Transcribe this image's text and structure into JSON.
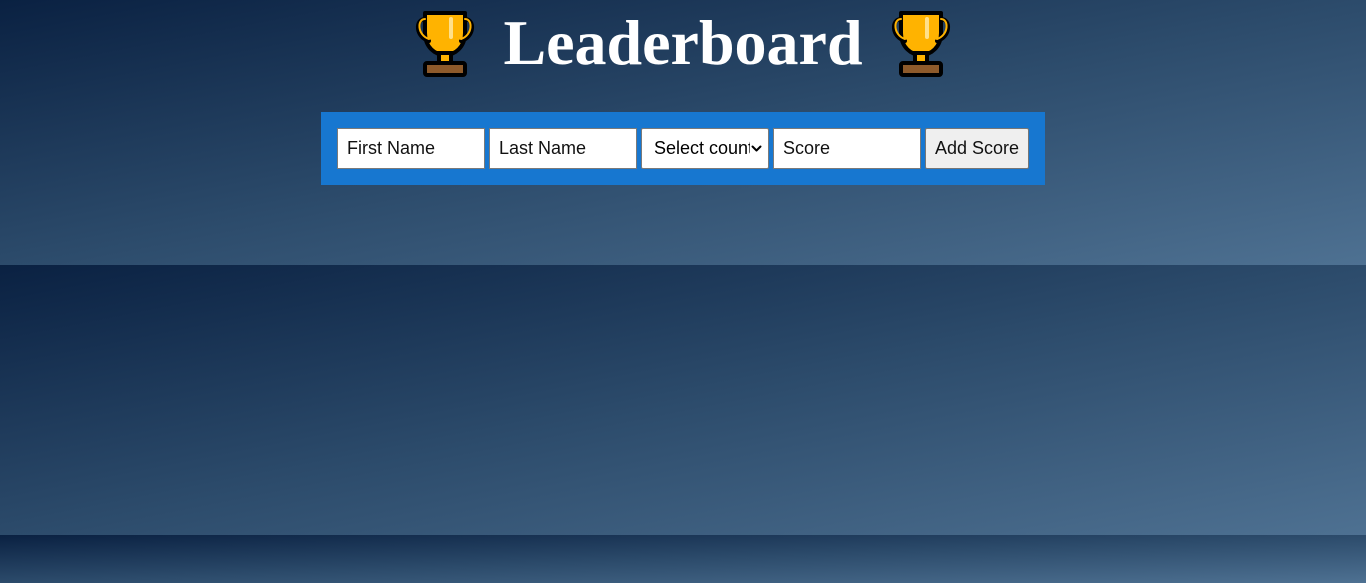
{
  "header": {
    "title": "Leaderboard",
    "left_icon": "trophy-icon",
    "right_icon": "trophy-icon"
  },
  "form": {
    "first_name_placeholder": "First Name",
    "last_name_placeholder": "Last Name",
    "country_select_value": "Select country",
    "score_placeholder": "Score",
    "submit_label": "Add Score"
  },
  "colors": {
    "form_background": "#1777d0",
    "page_gradient_start": "#0a2142",
    "page_gradient_end": "#4e7192",
    "trophy_gold": "#ffb300",
    "trophy_base": "#8d5a2b"
  }
}
